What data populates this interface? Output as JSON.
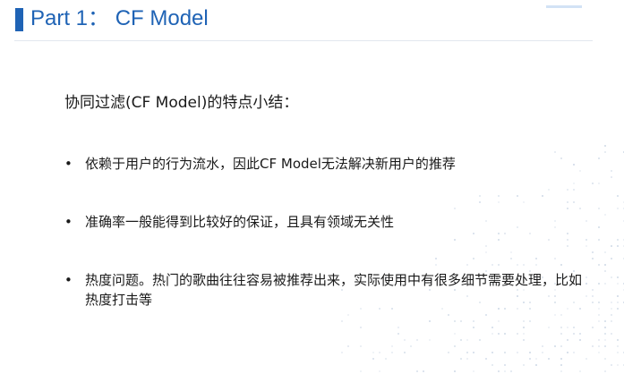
{
  "header": {
    "title": "Part 1： CF Model"
  },
  "content": {
    "intro": "协同过滤(CF Model)的特点小结：",
    "bullet_symbol": "•",
    "bullets": [
      "依赖于用户的行为流水，因此CF Model无法解决新用户的推荐",
      "准确率一般能得到比较好的保证，且具有领域无关性",
      "热度问题。热门的歌曲往往容易被推荐出来，实际使用中有很多细节需要处理，比如热度打击等"
    ]
  },
  "colors": {
    "accent": "#1f63b5",
    "text": "#1a1a1a",
    "background": "#ffffff",
    "decor_dots": "#c8d4e3"
  }
}
